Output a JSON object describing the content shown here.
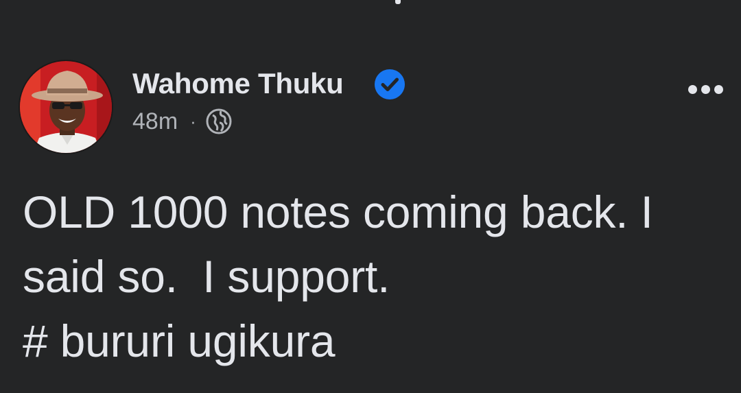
{
  "post": {
    "author": {
      "name": "Wahome Thuku",
      "verified": true,
      "avatar_icon": "profile-photo"
    },
    "timestamp": "48m",
    "separator": "·",
    "audience_icon": "globe-icon",
    "more_icon": "more-options-icon",
    "text_lines": [
      "OLD 1000 notes coming back. I",
      "said so.  I support.",
      "# bururi ugikura"
    ]
  },
  "colors": {
    "background": "#242526",
    "primary_text": "#e4e6eb",
    "secondary_text": "#b0b3b8",
    "verified_badge": "#1877f2"
  }
}
